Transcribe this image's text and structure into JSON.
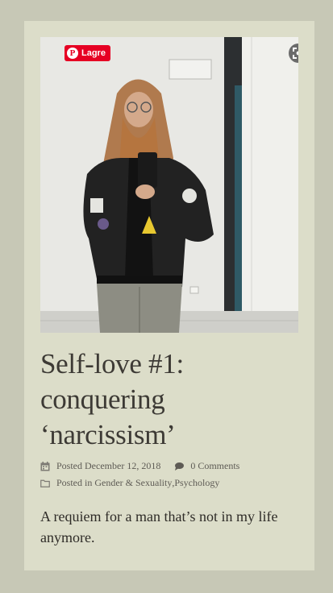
{
  "pinterest": {
    "save_label": "Lagre",
    "brand_color": "#e60023"
  },
  "post": {
    "title": "Self-love #1: conquering ‘narcissism’",
    "posted_prefix": "Posted",
    "date": "December 12, 2018",
    "comments": "0 Comments",
    "categories_prefix": "Posted in",
    "categories": [
      "Gender & Sexuality",
      "Psychology"
    ],
    "category_separator": ", ",
    "excerpt": "A requiem for a man that’s not in my life anymore."
  },
  "colors": {
    "page_background": "#c7c8b6",
    "card_background": "#dcddc9",
    "title_text": "#3d3a35"
  }
}
